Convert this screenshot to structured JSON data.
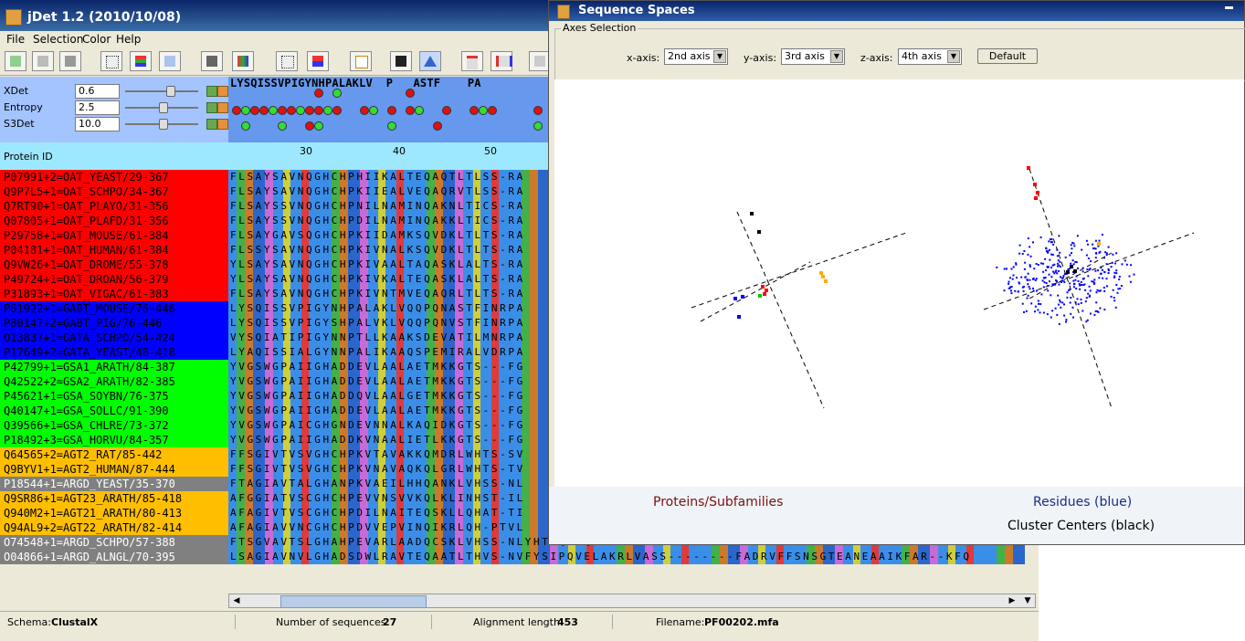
{
  "main_window": {
    "title": "jDet 1.2 (2010/10/08)",
    "menu": [
      "File",
      "Selection",
      "Color",
      "Help"
    ]
  },
  "controls": [
    {
      "label": "XDet",
      "value": "0.6",
      "slider": 0.6
    },
    {
      "label": "Entropy",
      "value": "2.5",
      "slider": 0.55
    },
    {
      "label": "S3Det",
      "value": "10.0",
      "slider": 0.5
    }
  ],
  "protein_id_header": "Protein ID",
  "consensus": "LYSQISSVPIGYNHPALAKLV  P   ASTF    PA",
  "ruler": [
    "30",
    "40",
    "50"
  ],
  "sequences": [
    {
      "id": "P07991+2=OAT_YEAST/29-367",
      "seq": "FLSAYSAVNQGHCHPHIIKALTEQAQTLTLSS-RA",
      "color": "#ff0000",
      "text": "#000000"
    },
    {
      "id": "Q9P7L5+1=OAT_SCHPO/34-367",
      "seq": "FLSAYSAVNQGHCHPKIIEALVEQAQRVTLSS-RA",
      "color": "#ff0000",
      "text": "#000000"
    },
    {
      "id": "Q7RT90+1=OAT_PLAYO/31-356",
      "seq": "FLSAYSSVNQGHCHPNILNAMINQAKNLTICS-RA",
      "color": "#ff0000",
      "text": "#000000"
    },
    {
      "id": "Q07805+1=OAT_PLAFD/31-356",
      "seq": "FLSAYSSVNQGHCHPDILNAMINQAKKLTICS-RA",
      "color": "#ff0000",
      "text": "#000000"
    },
    {
      "id": "P29758+1=OAT_MOUSE/61-384",
      "seq": "FLSAYGAVSQGHCHPKIIDAMKSQVDKLTLTS-RA",
      "color": "#ff0000",
      "text": "#000000"
    },
    {
      "id": "P04181+1=OAT_HUMAN/61-384",
      "seq": "FLSSYSAVNQGHCHPKIVNALKSQVDKLTLTS-RA",
      "color": "#ff0000",
      "text": "#000000"
    },
    {
      "id": "Q9VW26+1=OAT_DROME/55-378",
      "seq": "YLSAYSAVNQGHCHPKIVAALTAQASKLALTS-RA",
      "color": "#ff0000",
      "text": "#000000"
    },
    {
      "id": "P49724+1=OAT_DROAN/56-379",
      "seq": "YLSAYSAVNQGHCHPKIVKALTEQASKLALTS-RA",
      "color": "#ff0000",
      "text": "#000000"
    },
    {
      "id": "P31893+1=OAT_VIGAC/61-383",
      "seq": "FLSAYSAVNQGHCHPKIVNTMVEQAQRLTLTS-RA",
      "color": "#ff0000",
      "text": "#000000"
    },
    {
      "id": "P61922+1=GABT_MOUSE/76-446",
      "seq": "LYSQISSVPIGYNHPALAKLVQQPQNASTFINRPA",
      "color": "#0000ff",
      "text": "#000000"
    },
    {
      "id": "P80147+2=GABT_PIG/76-446",
      "seq": "LYSQISSVPIGYSHPALVKLVQQPQNVSTFINRPA",
      "color": "#0000ff",
      "text": "#000000"
    },
    {
      "id": "O13837+1=GATA_SCHPO/54-424",
      "seq": "VYSQIATIPIGYNNPTLLKAAKSDEVATILMNRPA",
      "color": "#0000ff",
      "text": "#000000"
    },
    {
      "id": "P17649+2=GATA_YEAST/48-418",
      "seq": "LYAQISSIALGYNNPALIKAAQSPEMIRALVDRPA",
      "color": "#0000ff",
      "text": "#000000"
    },
    {
      "id": "P42799+1=GSA1_ARATH/84-387",
      "seq": "YVGSWGPAIIGHADDEVLAALAETMKKGTS---FG",
      "color": "#00ff00",
      "text": "#000000"
    },
    {
      "id": "Q42522+2=GSA2_ARATH/82-385",
      "seq": "YVGSWGPAIIGHADDEVLAALAETMKKGTS---FG",
      "color": "#00ff00",
      "text": "#000000"
    },
    {
      "id": "P45621+1=GSA_SOYBN/76-375",
      "seq": "YVGSWGPAIIGHADDQVLAALGETMKKGTS---FG",
      "color": "#00ff00",
      "text": "#000000"
    },
    {
      "id": "Q40147+1=GSA_SOLLC/91-390",
      "seq": "YVGSWGPAIIGHADDEVLAALAETMKKGTS---FG",
      "color": "#00ff00",
      "text": "#000000"
    },
    {
      "id": "Q39566+1=GSA_CHLRE/73-372",
      "seq": "YVGSWGPAICGHGNDEVNNALKAQIDKGTS---FG",
      "color": "#00ff00",
      "text": "#000000"
    },
    {
      "id": "P18492+3=GSA_HORVU/84-357",
      "seq": "YVGSWGPAIIGHADDKVNAALIETLKKGTS---FG",
      "color": "#00ff00",
      "text": "#000000"
    },
    {
      "id": "Q64565+2=AGT2_RAT/85-442",
      "seq": "FFSGIVTVSVGHCHPKVTAVAKKQMDRLWHTS-SV",
      "color": "#ffbf00",
      "text": "#000000"
    },
    {
      "id": "Q9BYV1+1=AGT2_HUMAN/87-444",
      "seq": "FFSGIVTVSVGHCHPKVNAVAQKQLGRLWHTS-TV",
      "color": "#ffbf00",
      "text": "#000000"
    },
    {
      "id": "P18544+1=ARGD_YEAST/35-370",
      "seq": "FTAGIAVTALGHANPKVAEILHHQANKLVHSS-NL",
      "color": "#808080",
      "text": "#ffffff"
    },
    {
      "id": "Q9SR86+1=AGT23_ARATH/85-418",
      "seq": "AFGGIATVSCGHCHPEVVNSVVKQLKLINHST-IL",
      "color": "#ffbf00",
      "text": "#000000"
    },
    {
      "id": "Q940M2+1=AGT21_ARATH/80-413",
      "seq": "AFAGIVTVSCGHCHPDILNAITEQSKLLQHAT-TI",
      "color": "#ffbf00",
      "text": "#000000"
    },
    {
      "id": "Q94AL9+2=AGT22_ARATH/82-414",
      "seq": "AFAGIAVVNCGHCHPDVVEPVINQIKRLQH-PTVL",
      "color": "#ffbf00",
      "text": "#000000"
    },
    {
      "id": "O74548+1=ARGD_SCHPO/57-388",
      "seq": "FTSGVAVTSLGHAHPEVARLAADQCSKLVHSS-NLYHTSQAAQ",
      "color": "#808080",
      "text": "#ffffff"
    },
    {
      "id": "O04866+1=ARGD_ALNGL/70-395",
      "seq": "LSAGIAVNVLGHADSDWLRAVTEQAATLTHVS-NVFYSIPQVELAKRLVASS--------FADRVFFSNSGTEANEAAIKFAR--KFQ",
      "color": "#808080",
      "text": "#ffffff"
    }
  ],
  "status": {
    "schema_label": "Schema:",
    "schema_value": "ClustalX",
    "nseq_label": "Number of sequences:",
    "nseq_value": "27",
    "alen_label": "Alignment length:",
    "alen_value": "453",
    "file_label": "Filename:",
    "file_value": "PF00202.mfa"
  },
  "sequence_spaces": {
    "title": "Sequence Spaces",
    "axes_selection_label": "Axes Selection",
    "x_label": "x-axis:",
    "x_value": "2nd axis",
    "y_label": "y-axis:",
    "y_value": "3rd axis",
    "z_label": "z-axis:",
    "z_value": "4th axis",
    "default_button": "Default",
    "left_plot_label": "Proteins/Subfamilies",
    "right_plot_label": "Residues (blue)",
    "cluster_label": "Cluster Centers (black)",
    "colors": {
      "proteins": "#7a1010",
      "residues": "#1a2a8a",
      "points_red": "#ff0000",
      "points_blue": "#0000ff",
      "points_green": "#00cc00",
      "points_orange": "#ffaa00",
      "centers": "#000000"
    }
  }
}
